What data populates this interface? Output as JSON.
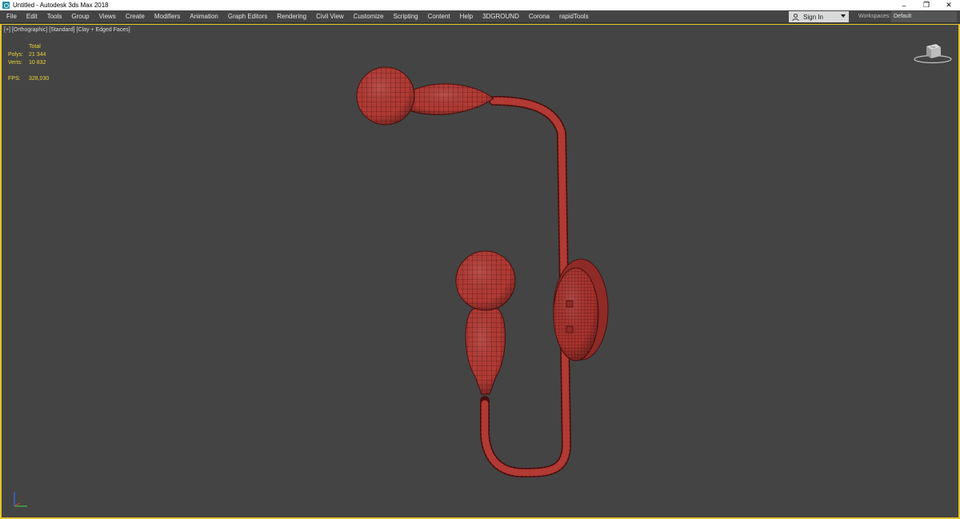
{
  "titlebar": {
    "title": "Untitled - Autodesk 3ds Max 2018",
    "controls": [
      "–",
      "❐",
      "✕"
    ]
  },
  "menu": {
    "items": [
      "File",
      "Edit",
      "Tools",
      "Group",
      "Views",
      "Create",
      "Modifiers",
      "Animation",
      "Graph Editors",
      "Rendering",
      "Civil View",
      "Customize",
      "Scripting",
      "Content",
      "Help",
      "3DGROUND",
      "Corona",
      "rapidTools"
    ],
    "signin_label": "Sign In",
    "workspaces_label": "Workspaces:",
    "workspaces_value": "Default"
  },
  "viewport": {
    "label_plus": "[+]",
    "label_view": "[Orthographic]",
    "label_shading": "[Standard]",
    "label_style": "[Clay + Edged Faces]",
    "stats": {
      "total_label": "Total",
      "polys_label": "Polys:",
      "polys_value": "21 344",
      "verts_label": "Verts:",
      "verts_value": "10 832",
      "fps_label": "FPS:",
      "fps_value": "328,030"
    },
    "viewcube_label": "TOP"
  },
  "colors": {
    "menubar_bg": "#444444",
    "viewport_bg": "#444444",
    "viewport_border": "#e6c42a",
    "mesh_fill": "#b13a34",
    "wire": "#4a0f0d"
  }
}
